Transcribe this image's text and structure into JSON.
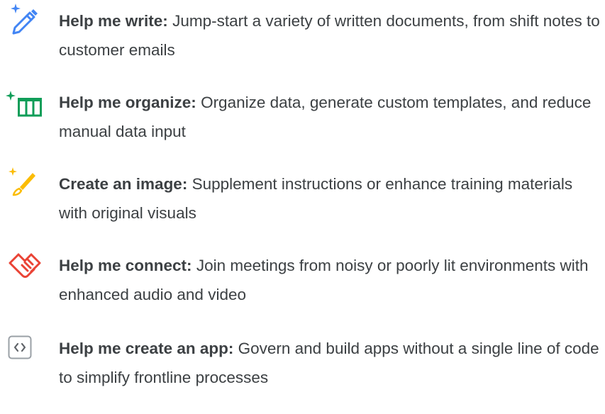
{
  "features": [
    {
      "title": "Help me write:",
      "description": "Jump-start a variety of written documents, from shift notes to customer emails",
      "icon": "pencil-sparkle-icon",
      "color": "#4285F4"
    },
    {
      "title": "Help me organize:",
      "description": "Organize data, generate custom templates, and reduce manual data input",
      "icon": "table-sparkle-icon",
      "color": "#0F9D58"
    },
    {
      "title": "Create an image:",
      "description": "Supplement instructions or enhance training materials with original visuals",
      "icon": "brush-sparkle-icon",
      "color": "#FBBC04"
    },
    {
      "title": "Help me connect:",
      "description": "Join meetings from noisy or poorly lit environments with enhanced audio and video",
      "icon": "handshake-icon",
      "color": "#EA4335"
    },
    {
      "title": "Help me create an app:",
      "description": "Govern and build apps without a single line of code to simplify frontline processes",
      "icon": "code-brackets-icon",
      "color": "#5F6368"
    }
  ]
}
